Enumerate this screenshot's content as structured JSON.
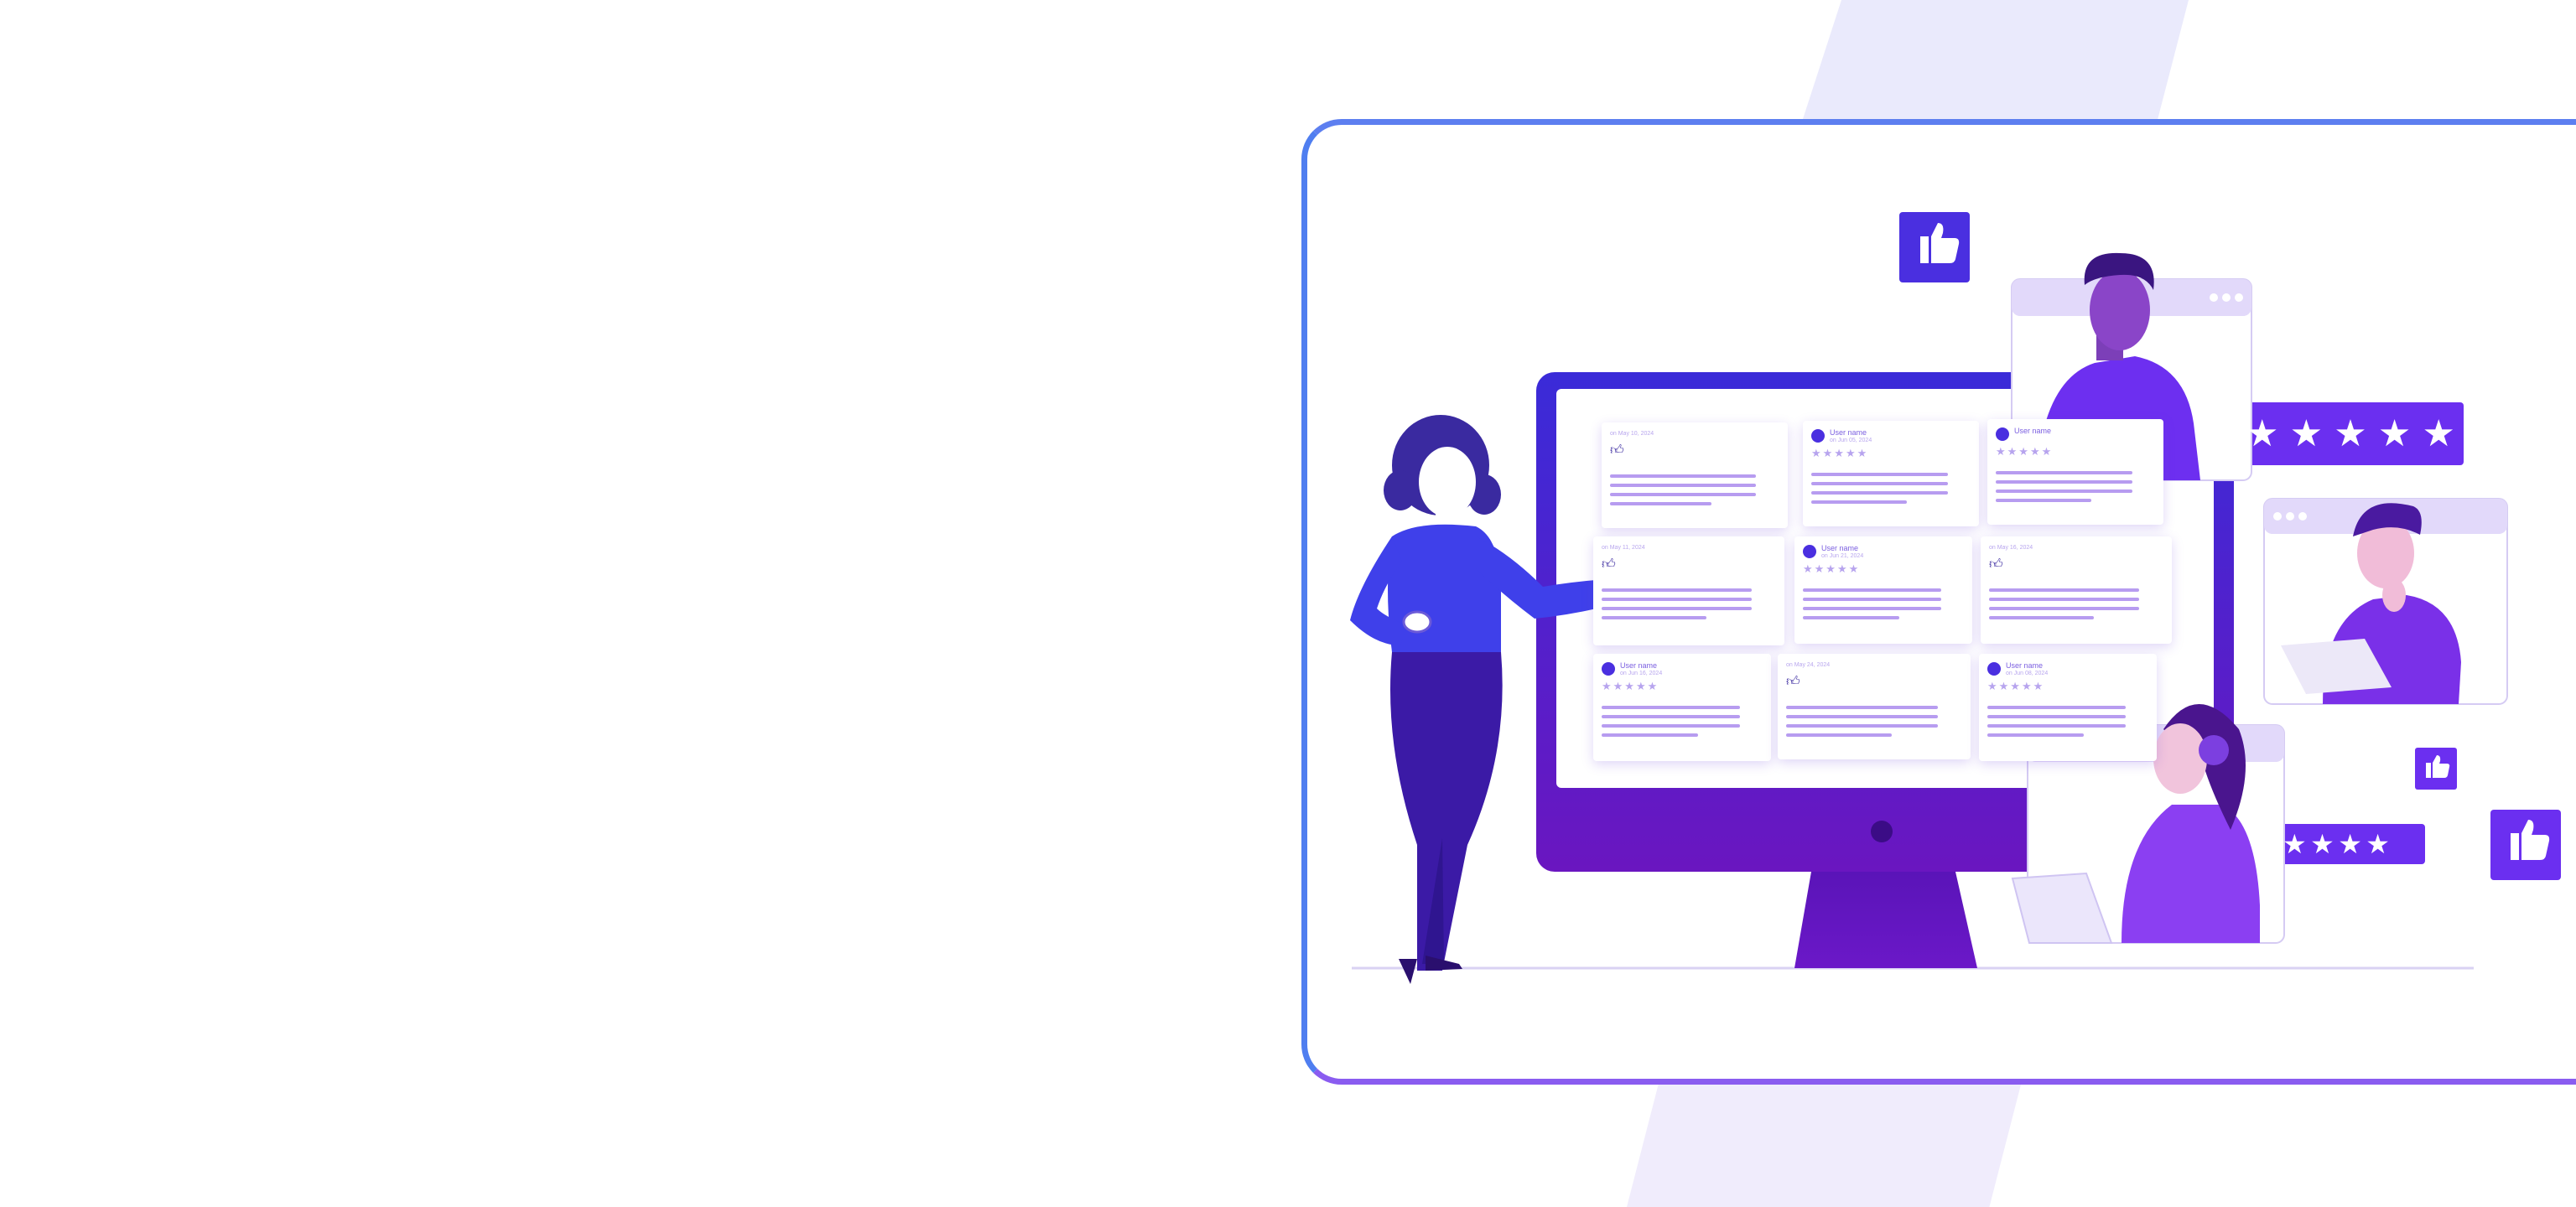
{
  "review_cards": [
    {
      "date": "on May 10, 2024",
      "kind": "like"
    },
    {
      "user": "User name",
      "date": "on Jun 05, 2024",
      "stars": 5,
      "kind": "user"
    },
    {
      "user": "User name",
      "date": "",
      "stars": 5,
      "kind": "user"
    },
    {
      "date": "on May 11, 2024",
      "kind": "like"
    },
    {
      "user": "User name",
      "date": "on Jun 21, 2024",
      "stars": 5,
      "kind": "user"
    },
    {
      "date": "on May 16, 2024",
      "kind": "like"
    },
    {
      "user": "User name",
      "date": "on Jun 16, 2024",
      "stars": 5,
      "kind": "user"
    },
    {
      "date": "on May 24, 2024",
      "kind": "like"
    },
    {
      "user": "User name",
      "date": "on Jun 08, 2024",
      "stars": 5,
      "kind": "user"
    }
  ],
  "ratings": [
    {
      "stars": 5
    },
    {
      "stars": 4
    }
  ],
  "icons": [
    "thumbs-up-icon",
    "star-icon",
    "window-dots-icon"
  ],
  "colors": {
    "accent": "#6b2ff0",
    "blue": "#3d47e8",
    "dark_purple": "#3a1aa3",
    "light_lavender": "#e4dcfa",
    "stripe": "#eceafc"
  }
}
